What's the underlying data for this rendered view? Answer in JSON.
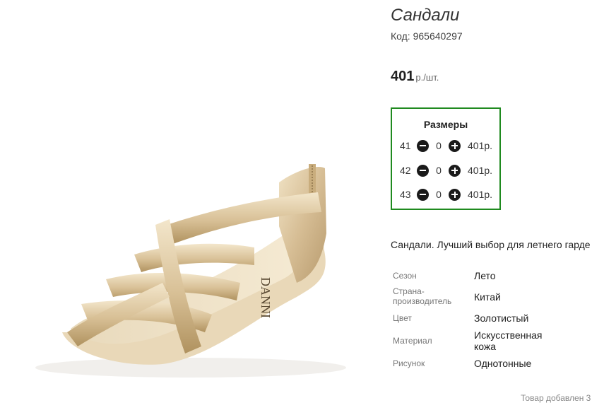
{
  "product": {
    "title": "Сандали",
    "code_label": "Код:",
    "code_value": "965640297",
    "price": "401",
    "price_unit": "р./шт."
  },
  "sizes": {
    "title": "Размеры",
    "rows": [
      {
        "size": "41",
        "qty": "0",
        "price": "401р."
      },
      {
        "size": "42",
        "qty": "0",
        "price": "401р."
      },
      {
        "size": "43",
        "qty": "0",
        "price": "401р."
      }
    ]
  },
  "description": "Сандали. Лучший выбор для летнего гарде",
  "properties": [
    {
      "label": "Сезон",
      "value": "Лето"
    },
    {
      "label": "Страна-производитель",
      "value": "Китай"
    },
    {
      "label": "Цвет",
      "value": "Золотистый"
    },
    {
      "label": "Материал",
      "value": "Искусственная кожа"
    },
    {
      "label": "Рисунок",
      "value": "Однотонные"
    }
  ],
  "footer_note": "Товар добавлен 3",
  "image_brand": "DANNI",
  "colors": {
    "border_accent": "#1f8a1f",
    "sandal_gold": "#d9c29a"
  }
}
